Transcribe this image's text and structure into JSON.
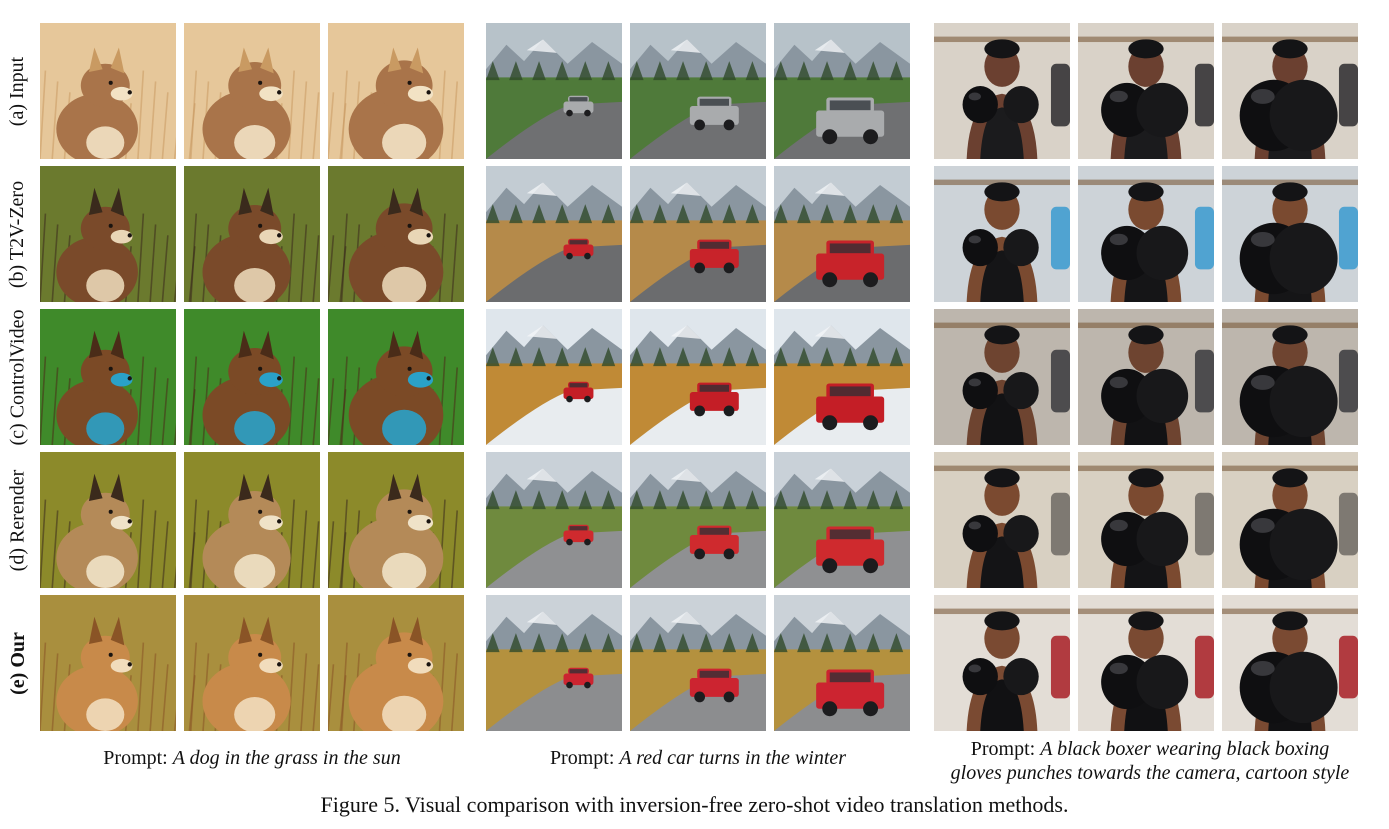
{
  "figure": {
    "caption": "Figure 5. Visual comparison with inversion-free zero-shot video translation methods.",
    "row_labels": [
      {
        "text": "(a) Input",
        "bold": false
      },
      {
        "text": "(b) T2V-Zero",
        "bold": false
      },
      {
        "text": "(c) ControlVideo",
        "bold": false
      },
      {
        "text": "(d) Rerender",
        "bold": false
      },
      {
        "text": "(e) Our",
        "bold": true
      }
    ],
    "groups": [
      {
        "prompt_prefix": "Prompt: ",
        "prompt_lines": [
          "A dog in the grass in the sun"
        ],
        "rows": [
          {
            "subject": "cat",
            "palette": {
              "bg": "#e6c79a",
              "mid": "#c99a62",
              "fg": "#a9744a",
              "accent": "#f2e2c4"
            }
          },
          {
            "subject": "dog",
            "palette": {
              "bg": "#6b7a2e",
              "mid": "#3a2a1c",
              "fg": "#7a4a2a",
              "accent": "#e9d6b6"
            }
          },
          {
            "subject": "dog",
            "palette": {
              "bg": "#3f8a2a",
              "mid": "#4a2c18",
              "fg": "#7b4a26",
              "accent": "#2aa1c8"
            }
          },
          {
            "subject": "dog",
            "palette": {
              "bg": "#8c8a2a",
              "mid": "#3b2a1c",
              "fg": "#b48a58",
              "accent": "#efe2c8"
            }
          },
          {
            "subject": "dog",
            "palette": {
              "bg": "#a98f3e",
              "mid": "#8a5426",
              "fg": "#c88a4a",
              "accent": "#f1dcbc"
            }
          }
        ]
      },
      {
        "prompt_prefix": "Prompt: ",
        "prompt_lines": [
          "A red car turns in the winter"
        ],
        "rows": [
          {
            "subject": "car",
            "palette": {
              "bg": "#b7c2c9",
              "mid": "#4f7a3a",
              "fg": "#a9abad",
              "accent": "#6f7072"
            }
          },
          {
            "subject": "car",
            "palette": {
              "bg": "#c3ccd3",
              "mid": "#b58a4a",
              "fg": "#c8232a",
              "accent": "#6b6c6e"
            }
          },
          {
            "subject": "car",
            "palette": {
              "bg": "#dfe6ec",
              "mid": "#c08a36",
              "fg": "#c41e26",
              "accent": "#e8ecef"
            }
          },
          {
            "subject": "car",
            "palette": {
              "bg": "#c9d1d8",
              "mid": "#6f8a3e",
              "fg": "#cf2a2e",
              "accent": "#8f9092"
            }
          },
          {
            "subject": "car",
            "palette": {
              "bg": "#cbd2d8",
              "mid": "#b4913e",
              "fg": "#cc2430",
              "accent": "#8c8d8f"
            }
          }
        ]
      },
      {
        "prompt_prefix": "Prompt: ",
        "prompt_lines": [
          "A black boxer wearing black boxing",
          "gloves punches towards the camera, cartoon style"
        ],
        "rows": [
          {
            "subject": "boxer",
            "palette": {
              "bg": "#d9d2c8",
              "mid": "#6b4030",
              "fg": "#1b1b1d",
              "accent": "#2b2b2e"
            }
          },
          {
            "subject": "boxer",
            "palette": {
              "bg": "#cdd3d8",
              "mid": "#7a4a30",
              "fg": "#151517",
              "accent": "#3a9ad0"
            }
          },
          {
            "subject": "boxer",
            "palette": {
              "bg": "#bdb6ad",
              "mid": "#6e4430",
              "fg": "#121214",
              "accent": "#3a3a3d"
            }
          },
          {
            "subject": "boxer",
            "palette": {
              "bg": "#d8d0c2",
              "mid": "#7b4a30",
              "fg": "#141416",
              "accent": "#6f6a64"
            }
          },
          {
            "subject": "boxer",
            "palette": {
              "bg": "#e3ddd6",
              "mid": "#7a4a32",
              "fg": "#111113",
              "accent": "#a81e26"
            }
          }
        ]
      }
    ]
  }
}
